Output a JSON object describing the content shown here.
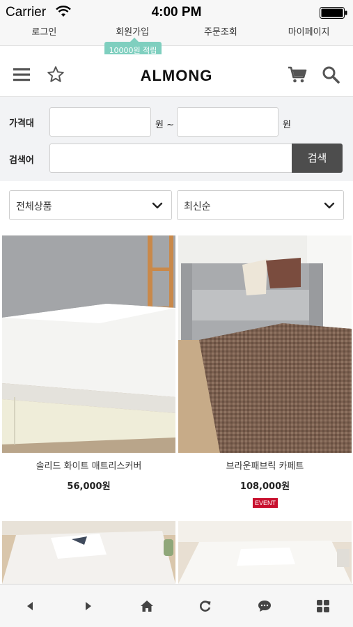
{
  "status_bar": {
    "carrier": "Carrier",
    "time": "4:00 PM"
  },
  "top_nav": {
    "items": [
      {
        "label": "로그인"
      },
      {
        "label": "회원가입"
      },
      {
        "label": "주문조회"
      },
      {
        "label": "마이페이지"
      }
    ],
    "signup_badge": "10000원 적립"
  },
  "header": {
    "logo": "ALMONG",
    "icons": [
      "menu-icon",
      "star-icon",
      "cart-icon",
      "search-icon"
    ]
  },
  "search": {
    "price_label": "가격대",
    "price_min_value": "",
    "price_max_value": "",
    "unit_min": "원 ~",
    "unit_max": "원",
    "keyword_label": "검색어",
    "keyword_value": "",
    "button_label": "검색"
  },
  "filters": {
    "category_selected": "전체상품",
    "sort_selected": "최신순"
  },
  "products": [
    {
      "name": "솔리드 화이트 매트리스커버",
      "price": "56,000원"
    },
    {
      "name": "브라운패브릭 카페트",
      "price": "108,000원",
      "badge": "EVENT"
    }
  ],
  "toolbar": {
    "icons": [
      "back-icon",
      "forward-icon",
      "home-icon",
      "refresh-icon",
      "chat-icon",
      "grid-icon"
    ]
  },
  "colors": {
    "badge_bg": "#7fcfbf",
    "search_button_bg": "#4d4d4d",
    "event_badge_bg": "#c8102e",
    "panel_bg": "#f2f3f5"
  }
}
